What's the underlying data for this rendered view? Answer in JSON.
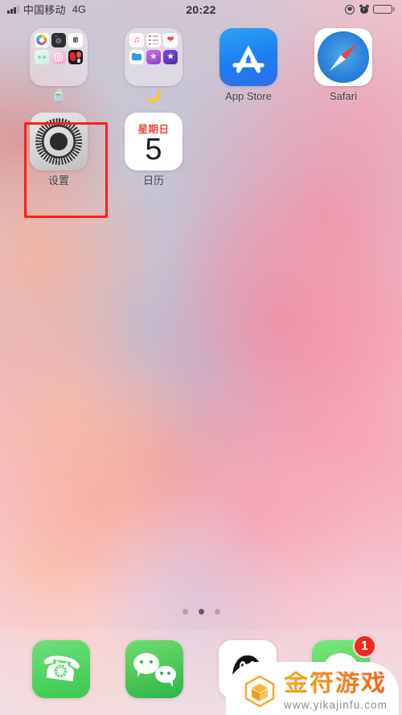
{
  "status_bar": {
    "carrier": "中国移动",
    "network": "4G",
    "time": "20:22",
    "signal_icon": "signal-bars-icon",
    "rotation_lock_icon": "rotation-lock-icon",
    "alarm_icon": "alarm-clock-icon",
    "battery_icon": "battery-full-icon"
  },
  "home_screen": {
    "row1": [
      {
        "type": "folder",
        "name": "folder-teacup",
        "label": "🍵",
        "apps": [
          {
            "name": "photos",
            "icon": "photos-icon"
          },
          {
            "name": "camera",
            "icon": "camera-icon"
          },
          {
            "name": "chinese-app",
            "icon": "app-icon",
            "text": "節"
          },
          {
            "name": "teal-app",
            "icon": "app-icon"
          },
          {
            "name": "instagram-like",
            "icon": "camera-app-icon"
          },
          {
            "name": "red-app",
            "icon": "app-icon"
          }
        ]
      },
      {
        "type": "folder",
        "name": "folder-moon",
        "label": "🌙",
        "apps": [
          {
            "name": "music",
            "icon": "music-note-icon"
          },
          {
            "name": "reminders",
            "icon": "reminders-list-icon"
          },
          {
            "name": "health",
            "icon": "heart-icon"
          },
          {
            "name": "files",
            "icon": "folder-icon"
          },
          {
            "name": "itunes-store",
            "icon": "star-icon"
          },
          {
            "name": "imovie",
            "icon": "star-icon"
          }
        ]
      },
      {
        "type": "app",
        "name": "app-store",
        "label": "App Store",
        "icon": "app-store-icon"
      },
      {
        "type": "app",
        "name": "safari",
        "label": "Safari",
        "icon": "safari-compass-icon"
      }
    ],
    "row2": [
      {
        "type": "app",
        "name": "settings",
        "label": "设置",
        "icon": "settings-gear-icon",
        "highlighted": true
      },
      {
        "type": "app",
        "name": "calendar",
        "label": "日历",
        "icon": "calendar-icon",
        "day_of_week": "星期日",
        "day_number": "5"
      }
    ],
    "page_dots": {
      "count": 3,
      "active_index": 1
    }
  },
  "dock": [
    {
      "name": "phone",
      "icon": "phone-handset-icon"
    },
    {
      "name": "wechat",
      "icon": "wechat-bubbles-icon"
    },
    {
      "name": "qq",
      "icon": "qq-penguin-icon"
    },
    {
      "name": "messages",
      "icon": "messages-bubble-icon",
      "badge": "1"
    }
  ],
  "watermark": {
    "brand": "金符游戏",
    "url": "www.yikajinfu.com",
    "logo_icon": "cube-logo-icon"
  },
  "colors": {
    "highlight_box": "#ff1f17",
    "badge_red": "#f5251f",
    "calendar_red": "#f0453a",
    "watermark_orange": "#f48b1f"
  }
}
